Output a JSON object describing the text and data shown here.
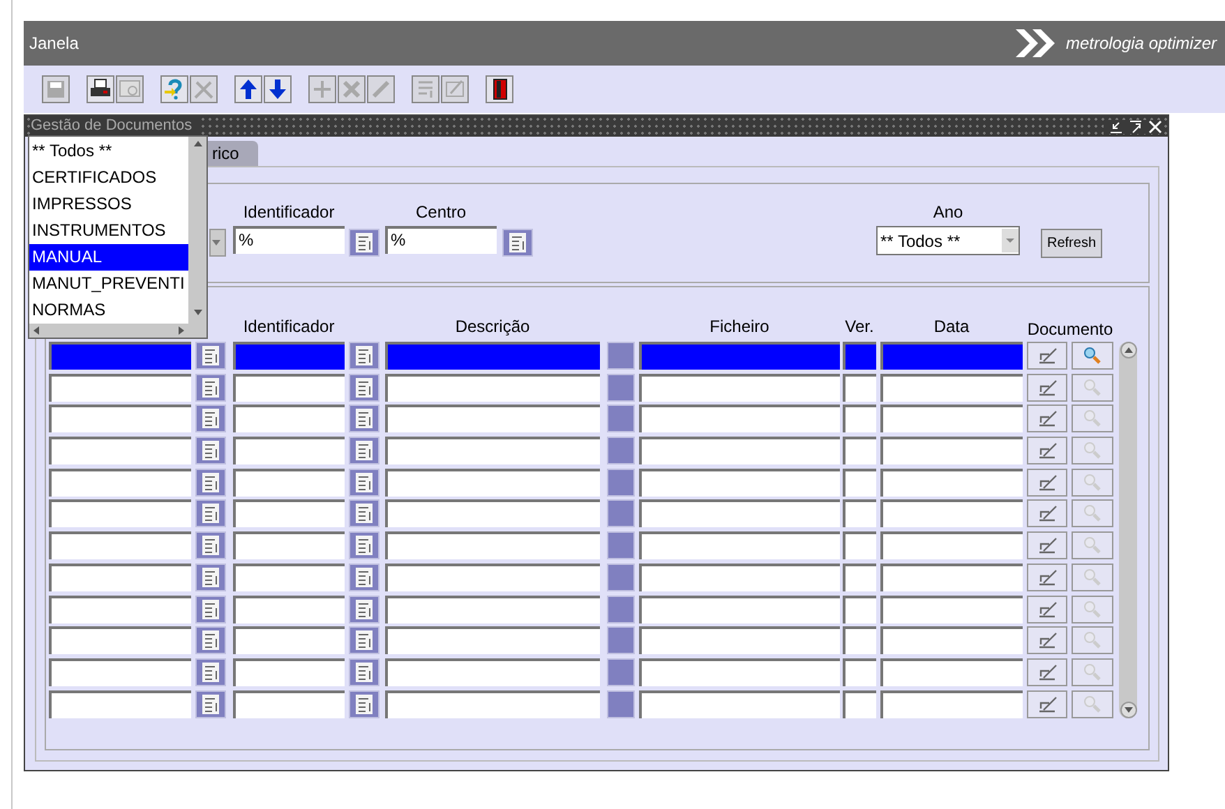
{
  "top_bar": {
    "menu": "Janela",
    "logo_text": "metrologia optimizer"
  },
  "toolbar": [
    {
      "kind": "save",
      "disabled": true
    },
    {
      "kind": "print",
      "disabled": false
    },
    {
      "kind": "preview",
      "disabled": true
    },
    {
      "kind": "help",
      "disabled": false
    },
    {
      "kind": "tools",
      "disabled": true
    },
    {
      "kind": "up",
      "disabled": false
    },
    {
      "kind": "down",
      "disabled": false
    },
    {
      "kind": "add",
      "disabled": true
    },
    {
      "kind": "delete",
      "disabled": true
    },
    {
      "kind": "pen",
      "disabled": true
    },
    {
      "kind": "list",
      "disabled": true
    },
    {
      "kind": "edit",
      "disabled": true
    },
    {
      "kind": "exit",
      "disabled": false
    }
  ],
  "window": {
    "title": "Gestão de Documentos",
    "tab": "rico"
  },
  "filters": {
    "identificador_label": "Identificador",
    "identificador_value": "%",
    "centro_label": "Centro",
    "centro_value": "%",
    "ano_label": "Ano",
    "ano_value": "** Todos **",
    "refresh": "Refresh"
  },
  "table": {
    "columns": [
      "Identificador",
      "Descrição",
      "Ficheiro",
      "Ver.",
      "Data",
      "Documento"
    ],
    "rows": [
      {
        "selected": true,
        "view_disabled": false
      },
      {
        "selected": false,
        "view_disabled": true
      },
      {
        "selected": false,
        "view_disabled": true
      },
      {
        "selected": false,
        "view_disabled": true
      },
      {
        "selected": false,
        "view_disabled": true
      },
      {
        "selected": false,
        "view_disabled": true
      },
      {
        "selected": false,
        "view_disabled": true
      },
      {
        "selected": false,
        "view_disabled": true
      },
      {
        "selected": false,
        "view_disabled": true
      },
      {
        "selected": false,
        "view_disabled": true
      },
      {
        "selected": false,
        "view_disabled": true
      },
      {
        "selected": false,
        "view_disabled": true
      }
    ]
  },
  "dropdown": {
    "items": [
      {
        "label": "** Todos **",
        "selected": false
      },
      {
        "label": "CERTIFICADOS",
        "selected": false
      },
      {
        "label": "IMPRESSOS",
        "selected": false
      },
      {
        "label": "INSTRUMENTOS",
        "selected": false
      },
      {
        "label": "MANUAL",
        "selected": true
      },
      {
        "label": "MANUT_PREVENTI",
        "selected": false
      },
      {
        "label": "NORMAS",
        "selected": false
      }
    ]
  }
}
